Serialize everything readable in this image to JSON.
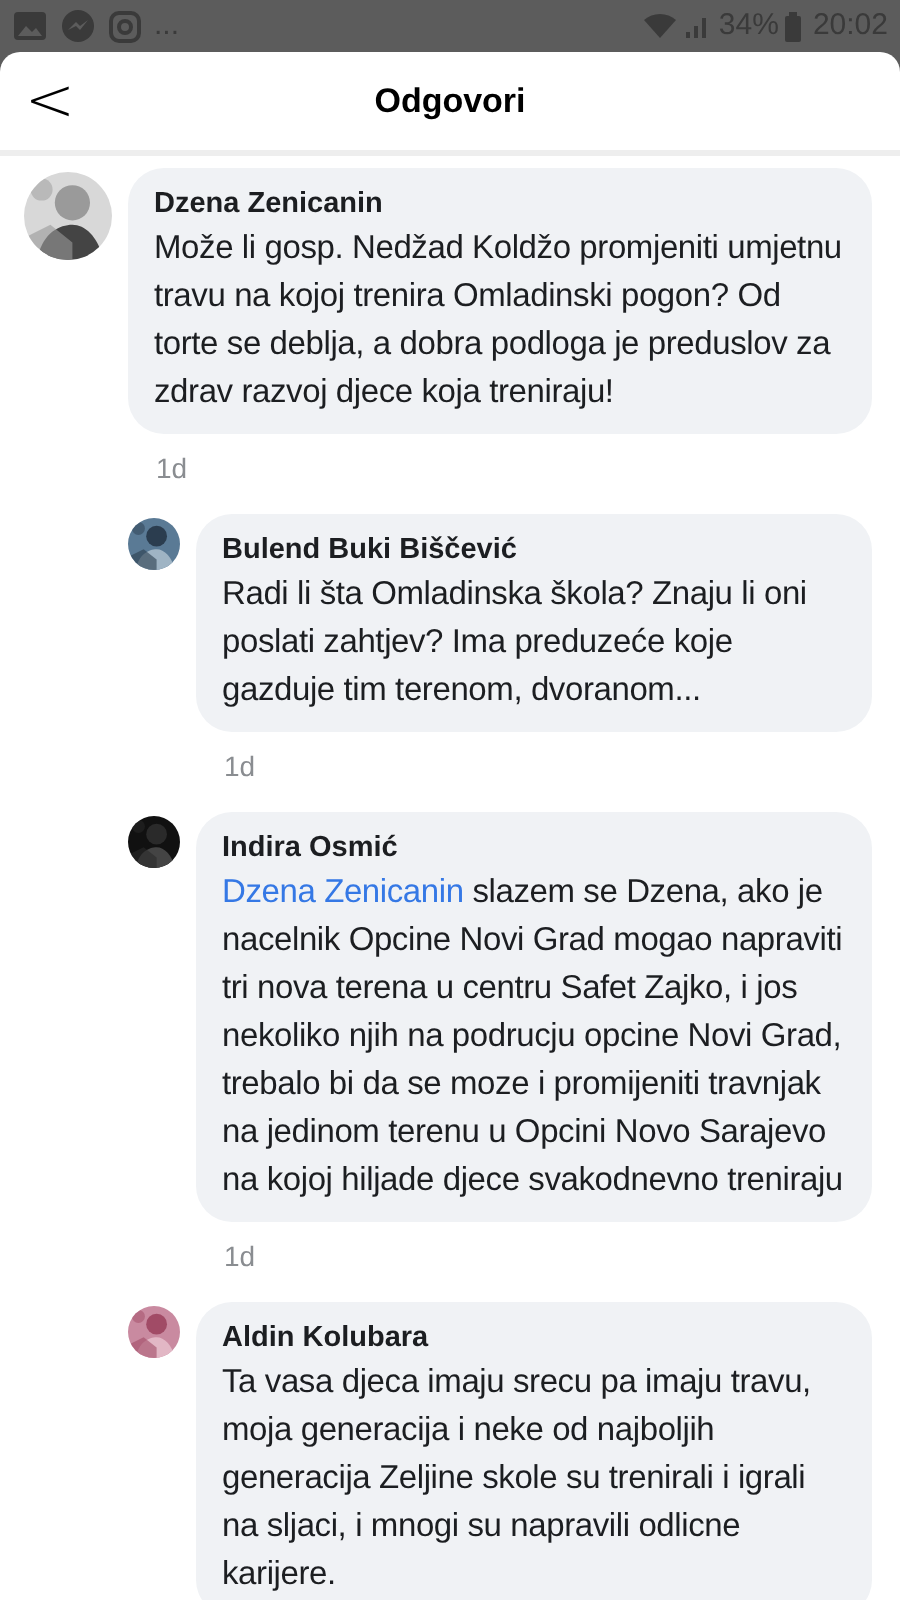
{
  "status_bar": {
    "overflow": "...",
    "battery": "34%",
    "time": "20:02"
  },
  "header": {
    "title": "Odgovori",
    "back": "<"
  },
  "comments": [
    {
      "kind": "comment",
      "author": "Dzena Zenicanin",
      "text": "Može li gosp. Nedžad Koldžo promjeniti umjetnu travu na kojoj trenira Omladinski pogon? Od torte se deblja, a dobra podloga je preduslov za zdrav razvoj djece koja treniraju!",
      "time": "1d"
    },
    {
      "kind": "reply",
      "author": "Bulend Buki Biščević",
      "text": "Radi li šta Omladinska škola? Znaju li oni poslati zahtjev? Ima preduzeće koje gazduje tim terenom, dvoranom...",
      "time": "1d"
    },
    {
      "kind": "reply",
      "author": "Indira Osmić",
      "mention": "Dzena Zenicanin",
      "text": "slazem se Dzena, ako je nacelnik Opcine Novi Grad mogao napraviti tri nova terena u centru Safet Zajko, i jos nekoliko njih na podrucju opcine Novi Grad, trebalo bi da se moze i promijeniti travnjak na jedinom terenu u Opcini Novo Sarajevo na kojoj hiljade djece svakodnevno treniraju",
      "time": "1d"
    },
    {
      "kind": "reply",
      "author": "Aldin Kolubara",
      "text": "Ta vasa djeca imaju srecu pa imaju travu, moja generacija i neke od najboljih generacija Zeljine skole su trenirali i igrali na sljaci, i mnogi su napravili odlicne karijere."
    }
  ]
}
